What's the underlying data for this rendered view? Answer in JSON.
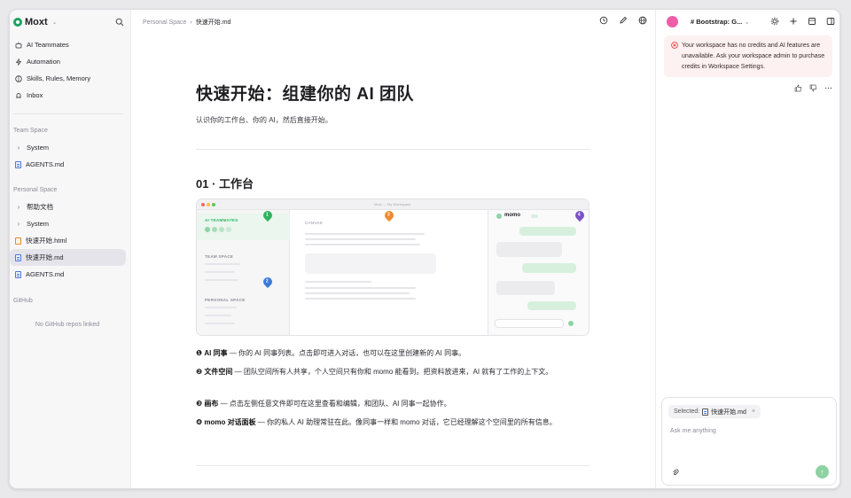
{
  "brand": {
    "name": "Moxt"
  },
  "sidebar": {
    "primary": [
      {
        "label": "AI Teammates",
        "icon": "robot-icon"
      },
      {
        "label": "Automation",
        "icon": "lightning-icon"
      },
      {
        "label": "Skills, Rules, Memory",
        "icon": "brain-icon"
      },
      {
        "label": "Inbox",
        "icon": "bell-icon"
      }
    ],
    "team_space": {
      "label": "Team Space",
      "items": [
        {
          "label": "System"
        },
        {
          "label": "AGENTS.md"
        }
      ]
    },
    "personal_space": {
      "label": "Personal Space",
      "items": [
        {
          "label": "帮助文档"
        },
        {
          "label": "System"
        },
        {
          "label": "快速开始.html"
        },
        {
          "label": "快速开始.md"
        },
        {
          "label": "AGENTS.md"
        }
      ]
    },
    "github": {
      "label": "GitHub",
      "empty": "No GitHub repos linked"
    }
  },
  "breadcrumb": {
    "parent": "Personal Space",
    "sep": "›",
    "current": "快速开始.md"
  },
  "doc": {
    "title": "快速开始：组建你的 AI 团队",
    "lead": "认识你的工作台、你的 AI，然后直接开始。",
    "section_title": "01 · 工作台",
    "preview": {
      "titlebar": "Moxt — My Workspace",
      "ai_teammates": "AI TEAMMATES",
      "team_space": "TEAM SPACE",
      "personal_space": "PERSONAL SPACE",
      "canvas": "CANVAS",
      "momo": "momo",
      "pins": [
        "1",
        "2",
        "3",
        "4"
      ]
    },
    "paras": [
      {
        "num": "❶",
        "bold": "AI 同事",
        "text": " — 你的 AI 同事列表。点击即可进入对话，也可以在这里创建新的 AI 同事。"
      },
      {
        "num": "❷",
        "bold": "文件空间",
        "text": " — 团队空间所有人共享，个人空间只有你和 momo 能看到。把资料放进来，AI 就有了工作的上下文。"
      },
      {
        "num": "❸",
        "bold": "画布",
        "text": " — 点击左侧任意文件即可在这里查看和编辑，和团队、AI 同事一起协作。"
      },
      {
        "num": "❹",
        "bold": "momo 对话面板",
        "text": " — 你的私人 AI 助理常驻在此。像同事一样和 momo 对话，它已经理解这个空间里的所有信息。"
      }
    ]
  },
  "right": {
    "title": "# Bootstrap: G...",
    "alert": "Your workspace has no credits and AI features are unavailable. Ask your workspace admin to purchase credits in Workspace Settings.",
    "composer": {
      "selected_label": "Selected:",
      "selected_file": "快速开始.md",
      "placeholder": "Ask me anything"
    }
  },
  "colors": {
    "accent": "#1fa35f",
    "pin1": "#2fb35f",
    "pin2": "#3b7ad8",
    "pin3": "#ee8a2a",
    "pin4": "#7b52c7",
    "alert_bg": "#fdf1f1",
    "alert_icon": "#e24b4b"
  }
}
